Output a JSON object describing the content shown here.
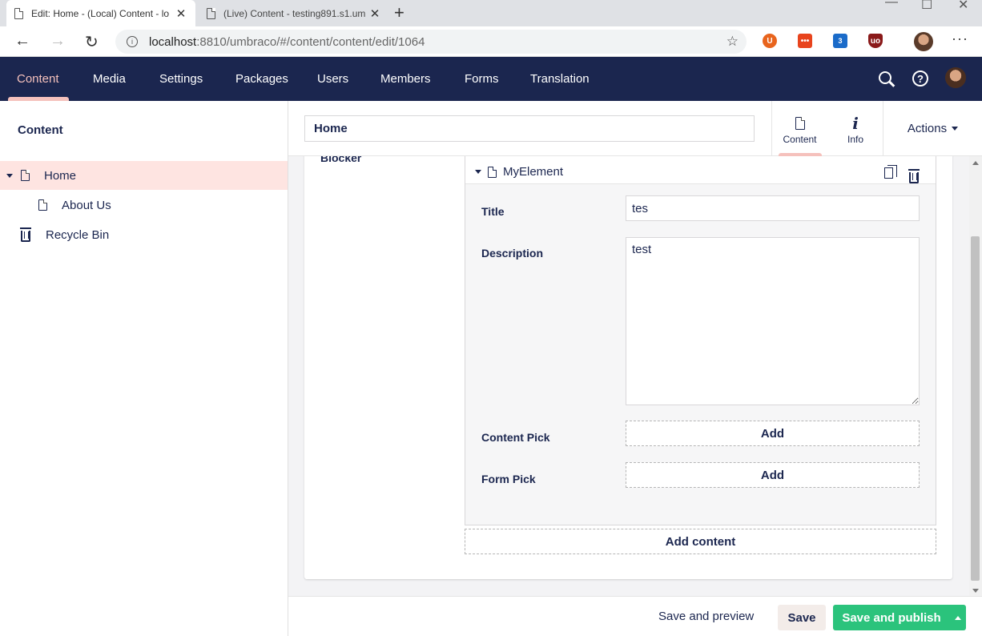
{
  "browser": {
    "tabs": [
      {
        "title": "Edit: Home - (Local) Content - lo",
        "close": "✕"
      },
      {
        "title": "(Live) Content - testing891.s1.um",
        "close": "✕"
      }
    ],
    "new_tab": "+",
    "window_controls": [
      "—",
      "☐",
      "✕"
    ],
    "url_host": "localhost",
    "url_path": ":8810/umbraco/#/content/content/edit/1064",
    "extensions": [
      {
        "name": "ublock-origin",
        "color": "#e8641d"
      },
      {
        "name": "toolbar-extension",
        "color": "#e8441d"
      },
      {
        "name": "counter-extension",
        "color": "#1a6bc9",
        "badge": "3"
      },
      {
        "name": "shield-extension",
        "color": "#8a1a1a"
      }
    ]
  },
  "header": {
    "nav": [
      "Content",
      "Media",
      "Settings",
      "Packages",
      "Users",
      "Members",
      "Forms",
      "Translation"
    ],
    "active_nav": "Content",
    "help_label": "?"
  },
  "tree": {
    "title": "Content",
    "items": [
      {
        "label": "Home"
      },
      {
        "label": "About Us"
      },
      {
        "label": "Recycle Bin"
      }
    ]
  },
  "editor": {
    "name_value": "Home",
    "apps": [
      {
        "label": "Content"
      },
      {
        "label": "Info",
        "glyph": "i"
      }
    ],
    "actions_label": "Actions",
    "property_label": "Blocker",
    "block": {
      "title": "MyElement",
      "fields": {
        "title_label": "Title",
        "title_value": "tes",
        "description_label": "Description",
        "description_value": "test",
        "content_pick_label": "Content Pick",
        "form_pick_label": "Form Pick",
        "add_label": "Add"
      }
    },
    "add_content_label": "Add content"
  },
  "footer": {
    "save_preview": "Save and preview",
    "save": "Save",
    "save_publish": "Save and publish"
  },
  "colors": {
    "header_bg": "#1b264f",
    "accent_pink": "#f5c1bc",
    "selected_row": "#fee4e1",
    "publish_green": "#2bc37c"
  }
}
